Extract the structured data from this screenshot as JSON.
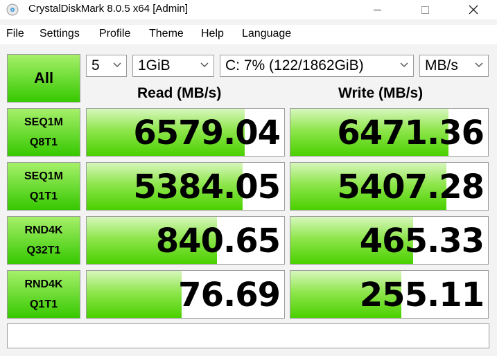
{
  "window": {
    "title": "CrystalDiskMark 8.0.5 x64 [Admin]",
    "icon": "crystaldiskmark-app-icon",
    "controls": [
      "minimize-icon",
      "maximize-icon",
      "close-icon"
    ]
  },
  "menu": {
    "items": [
      {
        "label": "File"
      },
      {
        "label": "Settings"
      },
      {
        "label": "Profile"
      },
      {
        "label": "Theme"
      },
      {
        "label": "Help"
      },
      {
        "label": "Language"
      }
    ]
  },
  "toolbar": {
    "all_label": "All",
    "count": "5",
    "size": "1GiB",
    "drive": "C: 7% (122/1862GiB)",
    "unit": "MB/s"
  },
  "headers": {
    "read": "Read (MB/s)",
    "write": "Write (MB/s)"
  },
  "tests": [
    {
      "line1": "SEQ1M",
      "line2": "Q8T1",
      "read": "6579.04",
      "write": "6471.36",
      "read_fill": 0.8,
      "write_fill": 0.8
    },
    {
      "line1": "SEQ1M",
      "line2": "Q1T1",
      "read": "5384.05",
      "write": "5407.28",
      "read_fill": 0.79,
      "write_fill": 0.79
    },
    {
      "line1": "RND4K",
      "line2": "Q32T1",
      "read": "840.65",
      "write": "465.33",
      "read_fill": 0.66,
      "write_fill": 0.62
    },
    {
      "line1": "RND4K",
      "line2": "Q1T1",
      "read": "76.69",
      "write": "255.11",
      "read_fill": 0.48,
      "write_fill": 0.56
    }
  ],
  "colors": {
    "accent_green": "#4ad000",
    "button_green": "#36c800",
    "window_bg": "#f3f3f3"
  },
  "status": ""
}
